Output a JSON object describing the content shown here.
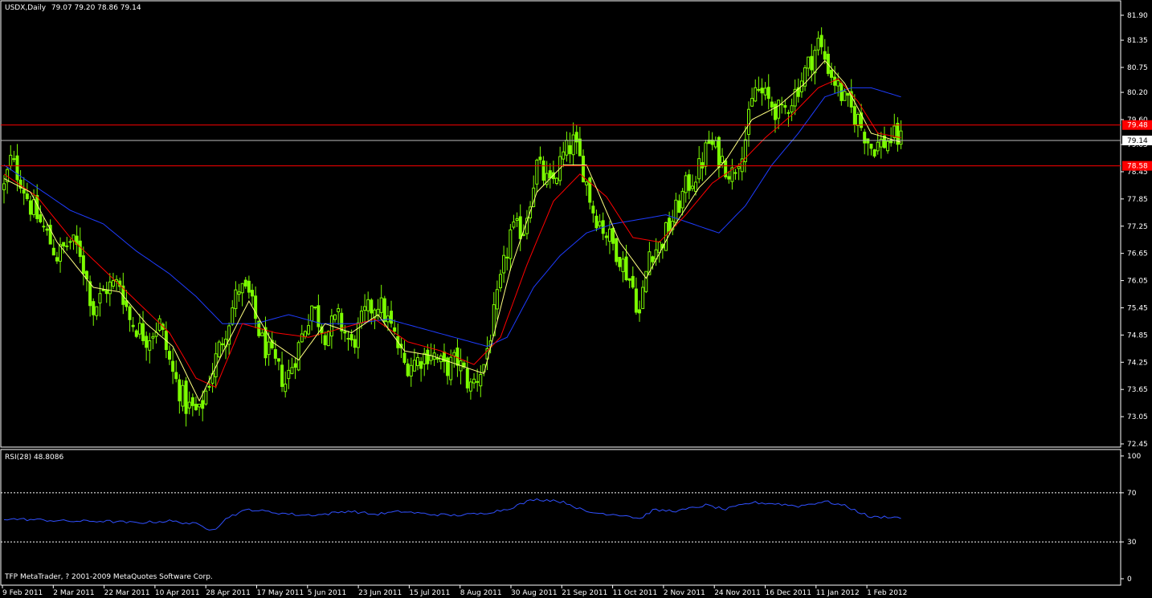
{
  "header": {
    "symbol": "USDX,Daily",
    "ohlc": "79.07 79.20 78.86 79.14"
  },
  "rsi_header": "RSI(28) 48.8086",
  "copyright": "TFP MetaTrader, ? 2001-2009 MetaQuotes Software Corp.",
  "colors": {
    "background": "#000000",
    "candle": "#7CFC00",
    "ma_fast": "#FFFF80",
    "ma_mid": "#FF0000",
    "ma_slow": "#1E3CFF",
    "rsi": "#3050FF",
    "hline": "#FF0000",
    "price_line": "#BBBBBB"
  },
  "chart_data": [
    {
      "type": "candlestick",
      "title": "USDX,Daily",
      "ylim": [
        72.45,
        81.9
      ],
      "y_ticks": [
        "81.90",
        "81.35",
        "80.75",
        "80.20",
        "79.60",
        "79.05",
        "78.45",
        "77.85",
        "77.25",
        "76.65",
        "76.05",
        "75.45",
        "74.85",
        "74.25",
        "73.65",
        "73.05",
        "72.45"
      ],
      "x_tick_labels": [
        "9 Feb 2011",
        "2 Mar 2011",
        "22 Mar 2011",
        "10 Apr 2011",
        "28 Apr 2011",
        "17 May 2011",
        "5 Jun 2011",
        "23 Jun 2011",
        "15 Jul 2011",
        "8 Aug 2011",
        "30 Aug 2011",
        "21 Sep 2011",
        "11 Oct 2011",
        "2 Nov 2011",
        "24 Nov 2011",
        "16 Dec 2011",
        "11 Jan 2012",
        "1 Feb 2012"
      ],
      "series": [
        {
          "name": "price",
          "anchors": [
            [
              0,
              78.1
            ],
            [
              2,
              78.7
            ],
            [
              5,
              78.3
            ],
            [
              8,
              77.7
            ],
            [
              12,
              77.2
            ],
            [
              16,
              76.6
            ],
            [
              20,
              76.9
            ],
            [
              23,
              76.7
            ],
            [
              27,
              75.4
            ],
            [
              31,
              75.9
            ],
            [
              35,
              76.0
            ],
            [
              38,
              75.2
            ],
            [
              43,
              74.8
            ],
            [
              47,
              75.1
            ],
            [
              51,
              74.0
            ],
            [
              55,
              73.3
            ],
            [
              59,
              73.1
            ],
            [
              63,
              74.1
            ],
            [
              67,
              75.0
            ],
            [
              71,
              75.9
            ],
            [
              74,
              75.7
            ],
            [
              78,
              74.7
            ],
            [
              81,
              74.3
            ],
            [
              85,
              73.8
            ],
            [
              89,
              74.6
            ],
            [
              93,
              75.5
            ],
            [
              97,
              74.9
            ],
            [
              101,
              75.2
            ],
            [
              105,
              74.6
            ],
            [
              109,
              75.3
            ],
            [
              113,
              75.6
            ],
            [
              117,
              75.0
            ],
            [
              121,
              74.2
            ],
            [
              125,
              74.3
            ],
            [
              129,
              74.5
            ],
            [
              133,
              74.1
            ],
            [
              137,
              74.3
            ],
            [
              141,
              73.7
            ],
            [
              145,
              74.2
            ],
            [
              149,
              75.6
            ],
            [
              153,
              77.1
            ],
            [
              157,
              77.2
            ],
            [
              161,
              78.6
            ],
            [
              165,
              78.1
            ],
            [
              169,
              78.8
            ],
            [
              172,
              79.1
            ],
            [
              175,
              78.5
            ],
            [
              178,
              77.6
            ],
            [
              182,
              77.1
            ],
            [
              186,
              76.6
            ],
            [
              190,
              75.9
            ],
            [
              192,
              75.3
            ],
            [
              195,
              76.7
            ],
            [
              198,
              76.8
            ],
            [
              202,
              77.4
            ],
            [
              206,
              78.1
            ],
            [
              210,
              78.5
            ],
            [
              213,
              79.1
            ],
            [
              216,
              78.8
            ],
            [
              220,
              78.4
            ],
            [
              224,
              79.2
            ],
            [
              227,
              80.3
            ],
            [
              231,
              80.0
            ],
            [
              235,
              79.7
            ],
            [
              239,
              80.2
            ],
            [
              243,
              80.8
            ],
            [
              246,
              81.3
            ],
            [
              250,
              80.6
            ],
            [
              254,
              80.0
            ],
            [
              258,
              79.6
            ],
            [
              262,
              79.0
            ],
            [
              266,
              79.1
            ],
            [
              269,
              79.2
            ],
            [
              271,
              79.14
            ]
          ]
        },
        {
          "name": "ma_fast",
          "anchors": [
            [
              0,
              78.3
            ],
            [
              8,
              78.0
            ],
            [
              16,
              76.9
            ],
            [
              27,
              75.9
            ],
            [
              35,
              75.8
            ],
            [
              43,
              75.1
            ],
            [
              51,
              74.6
            ],
            [
              59,
              73.4
            ],
            [
              67,
              74.6
            ],
            [
              74,
              75.6
            ],
            [
              81,
              74.7
            ],
            [
              89,
              74.3
            ],
            [
              97,
              75.1
            ],
            [
              105,
              74.9
            ],
            [
              113,
              75.3
            ],
            [
              121,
              74.5
            ],
            [
              129,
              74.4
            ],
            [
              137,
              74.2
            ],
            [
              145,
              74.0
            ],
            [
              153,
              76.3
            ],
            [
              161,
              78.0
            ],
            [
              169,
              78.6
            ],
            [
              176,
              78.6
            ],
            [
              186,
              76.9
            ],
            [
              194,
              76.1
            ],
            [
              202,
              77.2
            ],
            [
              210,
              78.1
            ],
            [
              218,
              78.7
            ],
            [
              226,
              79.6
            ],
            [
              234,
              79.9
            ],
            [
              242,
              80.4
            ],
            [
              248,
              80.9
            ],
            [
              254,
              80.4
            ],
            [
              262,
              79.3
            ],
            [
              271,
              79.1
            ]
          ]
        },
        {
          "name": "ma_mid",
          "anchors": [
            [
              0,
              78.4
            ],
            [
              10,
              77.9
            ],
            [
              20,
              77.0
            ],
            [
              30,
              76.3
            ],
            [
              40,
              75.6
            ],
            [
              50,
              74.9
            ],
            [
              58,
              73.9
            ],
            [
              64,
              73.7
            ],
            [
              72,
              75.1
            ],
            [
              82,
              74.9
            ],
            [
              92,
              74.8
            ],
            [
              102,
              75.0
            ],
            [
              112,
              75.2
            ],
            [
              122,
              74.7
            ],
            [
              132,
              74.5
            ],
            [
              142,
              74.2
            ],
            [
              150,
              74.8
            ],
            [
              158,
              76.4
            ],
            [
              166,
              77.8
            ],
            [
              174,
              78.4
            ],
            [
              182,
              77.9
            ],
            [
              190,
              77.0
            ],
            [
              198,
              76.9
            ],
            [
              206,
              77.5
            ],
            [
              214,
              78.2
            ],
            [
              222,
              78.6
            ],
            [
              230,
              79.2
            ],
            [
              238,
              79.7
            ],
            [
              246,
              80.3
            ],
            [
              252,
              80.5
            ],
            [
              258,
              80.0
            ],
            [
              264,
              79.3
            ],
            [
              271,
              79.2
            ]
          ]
        },
        {
          "name": "ma_slow",
          "anchors": [
            [
              0,
              78.6
            ],
            [
              10,
              78.1
            ],
            [
              20,
              77.6
            ],
            [
              30,
              77.3
            ],
            [
              40,
              76.7
            ],
            [
              50,
              76.2
            ],
            [
              58,
              75.7
            ],
            [
              66,
              75.1
            ],
            [
              76,
              75.1
            ],
            [
              86,
              75.3
            ],
            [
              96,
              75.1
            ],
            [
              106,
              75.1
            ],
            [
              116,
              75.2
            ],
            [
              126,
              75.0
            ],
            [
              136,
              74.8
            ],
            [
              146,
              74.6
            ],
            [
              152,
              74.8
            ],
            [
              160,
              75.9
            ],
            [
              168,
              76.6
            ],
            [
              176,
              77.1
            ],
            [
              184,
              77.3
            ],
            [
              192,
              77.4
            ],
            [
              200,
              77.5
            ],
            [
              208,
              77.3
            ],
            [
              216,
              77.1
            ],
            [
              224,
              77.7
            ],
            [
              232,
              78.6
            ],
            [
              240,
              79.3
            ],
            [
              248,
              80.1
            ],
            [
              256,
              80.3
            ],
            [
              262,
              80.3
            ],
            [
              271,
              80.1
            ]
          ]
        }
      ],
      "hlines": [
        79.48,
        78.58
      ],
      "hline_labels": [
        "79.48",
        "78.58"
      ],
      "current_price": 79.14,
      "current_price_label": "79.14"
    },
    {
      "type": "line",
      "title": "RSI(28) 48.8086",
      "ylim": [
        0,
        100
      ],
      "y_ticks": [
        "100",
        "70",
        "30",
        "0"
      ],
      "levels": [
        70,
        30
      ],
      "series": [
        {
          "name": "RSI(28)",
          "anchors": [
            [
              0,
              48.8
            ],
            [
              10,
              48.0
            ],
            [
              20,
              46.8
            ],
            [
              30,
              46.9
            ],
            [
              40,
              45.5
            ],
            [
              50,
              47.0
            ],
            [
              58,
              44.5
            ],
            [
              62,
              40.6
            ],
            [
              64,
              41.3
            ],
            [
              68,
              50.7
            ],
            [
              74,
              56.5
            ],
            [
              82,
              53.8
            ],
            [
              90,
              51.8
            ],
            [
              96,
              52.2
            ],
            [
              104,
              55.2
            ],
            [
              112,
              52.4
            ],
            [
              120,
              54.8
            ],
            [
              128,
              52.6
            ],
            [
              136,
              51.6
            ],
            [
              144,
              52.9
            ],
            [
              152,
              56.7
            ],
            [
              160,
              64.6
            ],
            [
              166,
              63.9
            ],
            [
              170,
              61.7
            ],
            [
              176,
              54.3
            ],
            [
              182,
              52.9
            ],
            [
              188,
              51.6
            ],
            [
              192,
              48.8
            ],
            [
              196,
              55.7
            ],
            [
              204,
              55.3
            ],
            [
              212,
              59.9
            ],
            [
              218,
              56.4
            ],
            [
              226,
              62.1
            ],
            [
              234,
              61.0
            ],
            [
              240,
              59.1
            ],
            [
              248,
              63.0
            ],
            [
              254,
              59.4
            ],
            [
              262,
              50.0
            ],
            [
              268,
              50.5
            ],
            [
              271,
              49.3
            ]
          ]
        }
      ]
    }
  ]
}
